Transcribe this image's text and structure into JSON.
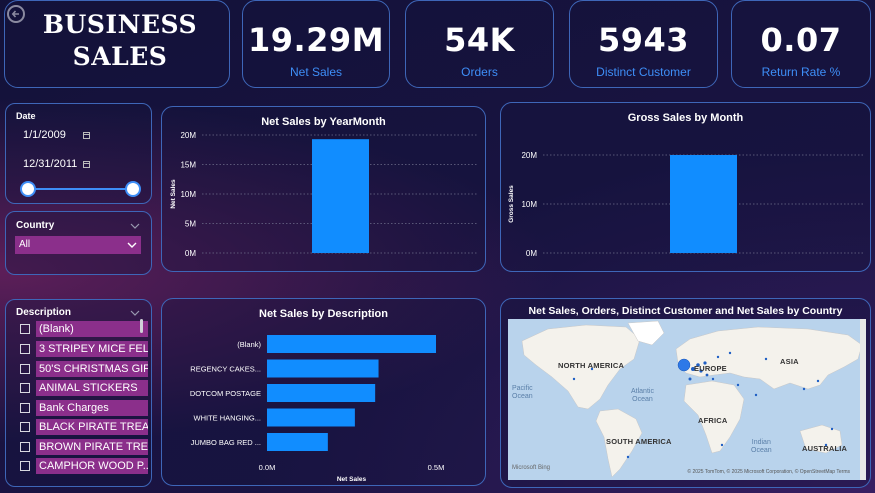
{
  "header": {
    "title": "BUSINESS SALES"
  },
  "kpis": [
    {
      "value": "19.29M",
      "label": "Net Sales"
    },
    {
      "value": "54K",
      "label": "Orders"
    },
    {
      "value": "5943",
      "label": "Distinct Customer"
    },
    {
      "value": "0.07",
      "label": "Return Rate %"
    }
  ],
  "date_slicer": {
    "label": "Date",
    "start": "1/1/2009",
    "end": "12/31/2011",
    "range": [
      0,
      1
    ]
  },
  "country_slicer": {
    "label": "Country",
    "selected": "All"
  },
  "description_slicer": {
    "label": "Description",
    "items": [
      "(Blank)",
      "3 STRIPEY MICE FELT...",
      "50'S CHRISTMAS GIF...",
      "ANIMAL STICKERS",
      "Bank Charges",
      "BLACK PIRATE TREAS...",
      "BROWN PIRATE TREA...",
      "CAMPHOR WOOD P..."
    ]
  },
  "colors": {
    "bar": "#118dff",
    "accent": "#3e8ef7",
    "item_bg": "#8b2f8b",
    "border": "#3e66b8"
  },
  "chart_data": [
    {
      "type": "bar",
      "title": "Net Sales by YearMonth",
      "ylabel": "Net Sales",
      "xlabel": "",
      "categories": [
        ""
      ],
      "values": [
        19.29
      ],
      "unit": "M",
      "ylim": [
        0,
        20
      ],
      "yticks": [
        "0M",
        "5M",
        "10M",
        "15M",
        "20M"
      ],
      "grid": true
    },
    {
      "type": "bar",
      "title": "Gross Sales by Month",
      "ylabel": "Gross Sales",
      "xlabel": "",
      "categories": [
        ""
      ],
      "values": [
        20.7
      ],
      "unit": "M",
      "ylim": [
        0,
        20
      ],
      "yticks": [
        "0M",
        "10M",
        "20M"
      ],
      "grid": true
    },
    {
      "type": "bar",
      "orientation": "horizontal",
      "title": "Net Sales by Description",
      "xlabel": "Net Sales",
      "categories": [
        "(Blank)",
        "REGENCY CAKES...",
        "DOTCOM POSTAGE",
        "WHITE HANGING...",
        "JUMBO BAG RED ..."
      ],
      "values": [
        0.5,
        0.33,
        0.32,
        0.26,
        0.18
      ],
      "unit": "M",
      "xlim": [
        0,
        0.5
      ],
      "xticks": [
        "0.0M",
        "0.5M"
      ]
    }
  ],
  "map": {
    "title": "Net Sales, Orders, Distinct Customer and Net Sales by Country",
    "labels": [
      "NORTH AMERICA",
      "EUROPE",
      "ASIA",
      "AFRICA",
      "SOUTH AMERICA",
      "AUSTRALIA"
    ],
    "oceans": [
      "Pacific\nOcean",
      "Atlantic\nOcean",
      "Indian\nOcean"
    ],
    "brand": "Microsoft Bing",
    "attribution": "© 2025 TomTom, © 2025 Microsoft Corporation, © OpenStreetMap Terms"
  }
}
